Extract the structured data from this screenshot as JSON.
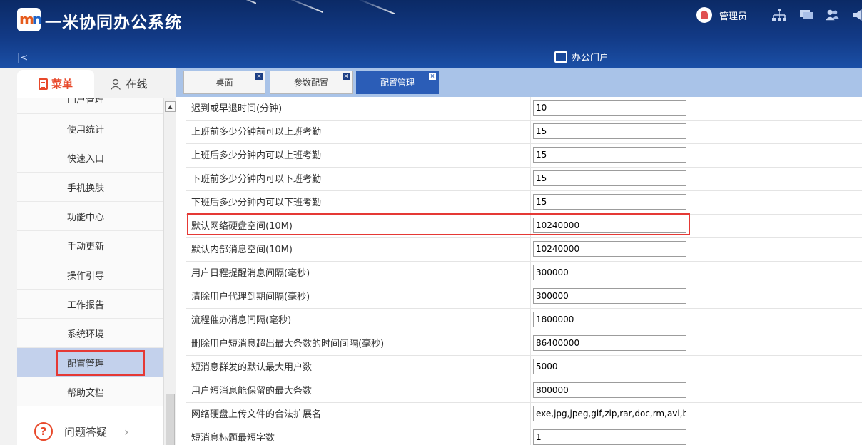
{
  "header": {
    "title": "一米协同办公系统",
    "user_name": "管理员",
    "portal_label": "办公门户",
    "colors": {
      "header_bg": "#123a86",
      "accent": "#e8492b",
      "active_tab": "#2b5db7"
    }
  },
  "left_tabs": {
    "menu": "菜单",
    "online": "在线"
  },
  "menu_items": [
    "门户管理",
    "使用统计",
    "快速入口",
    "手机换肤",
    "功能中心",
    "手动更新",
    "操作引导",
    "工作报告",
    "系统环境",
    "配置管理",
    "帮助文档"
  ],
  "menu_active": "配置管理",
  "help_label": "问题答疑",
  "tabs": [
    {
      "label": "桌面"
    },
    {
      "label": "参数配置"
    },
    {
      "label": "配置管理"
    }
  ],
  "config_rows": [
    {
      "label": "迟到或早退时间(分钟)",
      "value": "10"
    },
    {
      "label": "上班前多少分钟前可以上班考勤",
      "value": "15"
    },
    {
      "label": "上班后多少分钟内可以上班考勤",
      "value": "15"
    },
    {
      "label": "下班前多少分钟内可以下班考勤",
      "value": "15"
    },
    {
      "label": "下班后多少分钟内可以下班考勤",
      "value": "15"
    },
    {
      "label": "默认网络硬盘空间(10M)",
      "value": "10240000"
    },
    {
      "label": "默认内部消息空间(10M)",
      "value": "10240000"
    },
    {
      "label": "用户日程提醒消息间隔(毫秒)",
      "value": "300000"
    },
    {
      "label": "清除用户代理到期间隔(毫秒)",
      "value": "300000"
    },
    {
      "label": "流程催办消息间隔(毫秒)",
      "value": "1800000"
    },
    {
      "label": "删除用户短消息超出最大条数的时间间隔(毫秒)",
      "value": "86400000"
    },
    {
      "label": "短消息群发的默认最大用户数",
      "value": "5000"
    },
    {
      "label": "用户短消息能保留的最大条数",
      "value": "800000"
    },
    {
      "label": "网络硬盘上传文件的合法扩展名",
      "value": "exe,jpg,jpeg,gif,zip,rar,doc,rm,avi,bmp"
    },
    {
      "label": "短消息标题最短字数",
      "value": "1"
    }
  ]
}
